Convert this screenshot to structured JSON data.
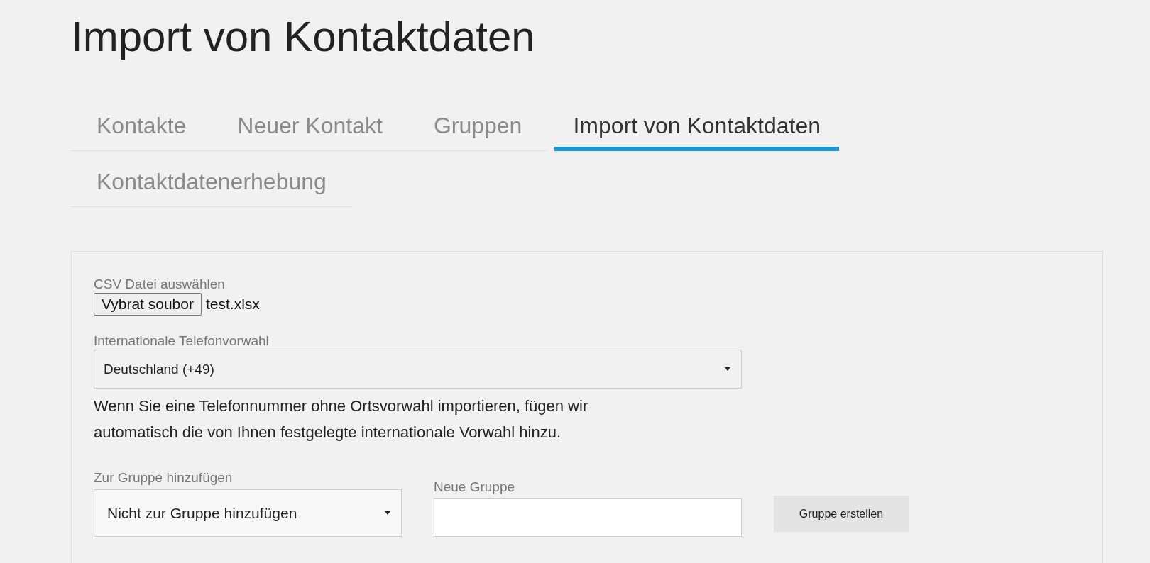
{
  "page_title": "Import von Kontaktdaten",
  "tabs": [
    {
      "label": "Kontakte",
      "selected": false
    },
    {
      "label": "Neuer Kontakt",
      "selected": false
    },
    {
      "label": "Gruppen",
      "selected": false
    },
    {
      "label": "Import von Kontaktdaten",
      "selected": true
    },
    {
      "label": "Kontaktdatenerhebung",
      "selected": false
    }
  ],
  "form": {
    "file": {
      "label": "CSV Datei auswählen",
      "button": "Vybrat soubor",
      "filename": "test.xlsx"
    },
    "prefix": {
      "label": "Internationale Telefonvorwahl",
      "value": "Deutschland (+49)"
    },
    "hint": "Wenn Sie eine Telefonnummer ohne Ortsvorwahl importieren, fügen wir automatisch die von Ihnen festgelegte internationale Vorwahl hinzu.",
    "group": {
      "label": "Zur Gruppe hinzufügen",
      "value": "Nicht zur Gruppe hinzufügen"
    },
    "new_group": {
      "label": "Neue Gruppe"
    },
    "create_button": "Gruppe erstellen"
  }
}
